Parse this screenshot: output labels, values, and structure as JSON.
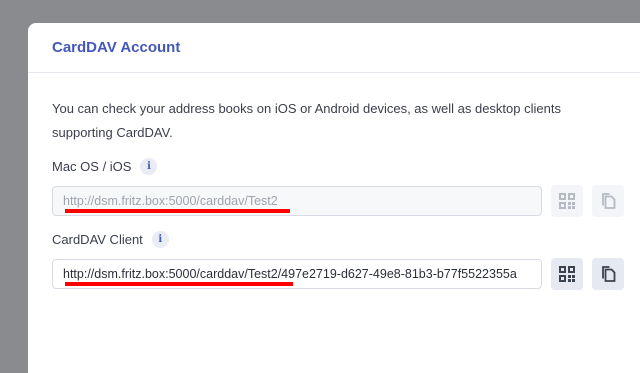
{
  "panel": {
    "title": "CardDAV Account",
    "description": "You can check your address books on iOS or Android devices, as well as desktop clients supporting CardDAV."
  },
  "fields": [
    {
      "label": "Mac OS / iOS",
      "info_glyph": "i",
      "value": "http://dsm.fritz.box:5000/carddav/Test2",
      "state": "disabled",
      "qr_icon": "qr-code-icon",
      "copy_icon": "copy-icon"
    },
    {
      "label": "CardDAV Client",
      "info_glyph": "i",
      "value": "http://dsm.fritz.box:5000/carddav/Test2/497e2719-d627-49e8-81b3-b77f5522355a",
      "state": "enabled",
      "qr_icon": "qr-code-icon",
      "copy_icon": "copy-icon"
    }
  ],
  "colors": {
    "accent": "#4459b7",
    "redaction": "#ff0000",
    "backdrop": "#8a8b8f"
  }
}
